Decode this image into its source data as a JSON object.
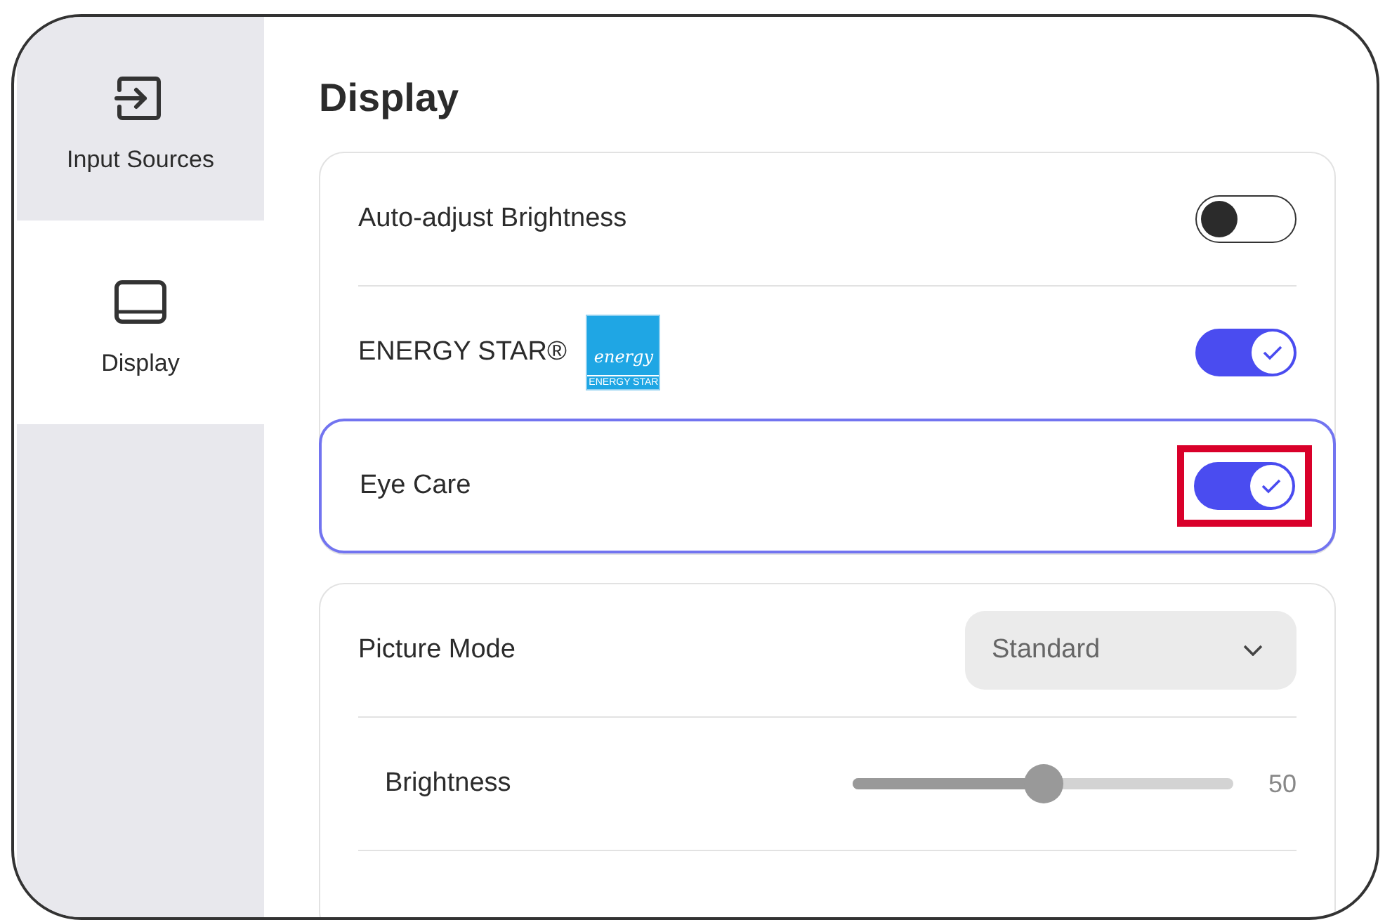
{
  "sidebar": {
    "items": [
      {
        "label": "Input Sources",
        "selected": false
      },
      {
        "label": "Display",
        "selected": true
      }
    ]
  },
  "title": "Display",
  "sections": [
    {
      "rows": [
        {
          "kind": "toggle",
          "label": "Auto-adjust Brightness",
          "on": false,
          "focused": false,
          "annotated": false
        },
        {
          "kind": "toggle",
          "label": "ENERGY STAR®",
          "logo": {
            "script": "energy",
            "caption": "ENERGY STAR"
          },
          "on": true,
          "focused": false,
          "annotated": false
        },
        {
          "kind": "toggle",
          "label": "Eye Care",
          "on": true,
          "focused": true,
          "annotated": true
        }
      ]
    },
    {
      "rows": [
        {
          "kind": "dropdown",
          "label": "Picture Mode",
          "value": "Standard"
        },
        {
          "kind": "slider",
          "label": "Brightness",
          "level": 0.5,
          "reading": "50"
        }
      ]
    }
  ]
}
